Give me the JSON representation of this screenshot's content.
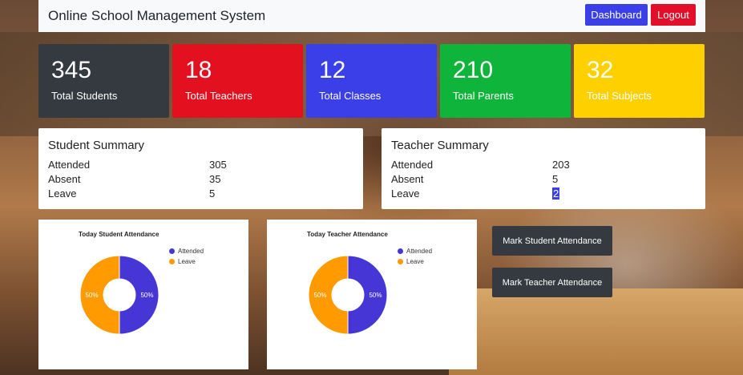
{
  "app": {
    "title": "Online School Management System"
  },
  "nav": {
    "dashboard_label": "Dashboard",
    "logout_label": "Logout"
  },
  "stats": [
    {
      "value": "345",
      "label": "Total Students",
      "color": "#343a40"
    },
    {
      "value": "18",
      "label": "Total Teachers",
      "color": "#e3101f"
    },
    {
      "value": "12",
      "label": "Total Classes",
      "color": "#3b3fe8"
    },
    {
      "value": "210",
      "label": "Total Parents",
      "color": "#0fb43a"
    },
    {
      "value": "32",
      "label": "Total Subjects",
      "color": "#ffd000"
    }
  ],
  "student_summary": {
    "title": "Student Summary",
    "rows": [
      {
        "label": "Attended",
        "value": "305"
      },
      {
        "label": "Absent",
        "value": "35"
      },
      {
        "label": "Leave",
        "value": "5"
      }
    ]
  },
  "teacher_summary": {
    "title": "Teacher Summary",
    "rows": [
      {
        "label": "Attended",
        "value": "203"
      },
      {
        "label": "Absent",
        "value": "5"
      },
      {
        "label": "Leave",
        "value": "2"
      }
    ]
  },
  "charts": [
    {
      "chart_data": {
        "type": "pie",
        "title": "Today Student Attendance",
        "categories": [
          "Attended",
          "Leave"
        ],
        "values": [
          50,
          50
        ],
        "value_labels": [
          "50%",
          "50%"
        ],
        "colors": [
          "#4636d6",
          "#ff9a00"
        ],
        "legend": "top-right"
      }
    },
    {
      "chart_data": {
        "type": "pie",
        "title": "Today Teacher Attendance",
        "categories": [
          "Attended",
          "Leave"
        ],
        "values": [
          50,
          50
        ],
        "value_labels": [
          "50%",
          "50%"
        ],
        "colors": [
          "#4636d6",
          "#ff9a00"
        ],
        "legend": "top-right"
      }
    }
  ],
  "actions": {
    "mark_student_label": "Mark Student Attendance",
    "mark_teacher_label": "Mark Teacher Attendance"
  }
}
